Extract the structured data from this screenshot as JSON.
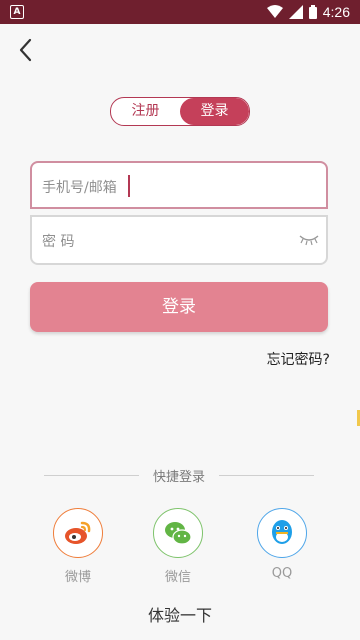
{
  "statusbar": {
    "time": "4:26",
    "left_badge": "A"
  },
  "tabs": [
    {
      "label": "注册",
      "active": false
    },
    {
      "label": "登录",
      "active": true
    }
  ],
  "form": {
    "account_placeholder": "手机号/邮箱",
    "password_placeholder": "密 码",
    "login_label": "登录",
    "forgot_label": "忘记密码?"
  },
  "quick_login": {
    "title": "快捷登录",
    "options": [
      {
        "label": "微博",
        "icon": "weibo-icon"
      },
      {
        "label": "微信",
        "icon": "wechat-icon"
      },
      {
        "label": "QQ",
        "icon": "qq-icon"
      }
    ]
  },
  "trial_label": "体验一下",
  "colors": {
    "statusbar": "#6f1f2e",
    "accent": "#c5405a",
    "button": "#e38391",
    "weibo": "#ef7d3a",
    "wechat": "#7ec36b",
    "qq": "#4fa6e9"
  }
}
